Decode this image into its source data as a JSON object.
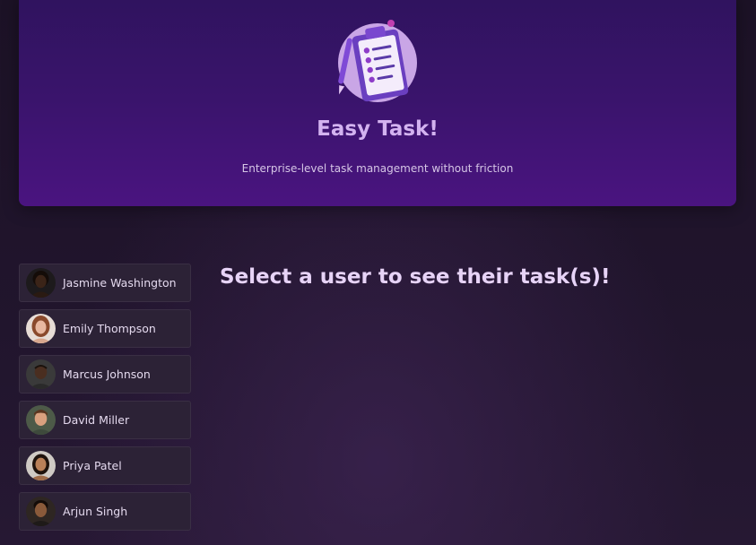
{
  "header": {
    "logo_icon": "clipboard-checklist-icon",
    "title": "Easy Task!",
    "subtitle": "Enterprise-level task management without friction"
  },
  "users": [
    {
      "name": "Jasmine Washington",
      "avatar_icon": "avatar-jasmine",
      "skin": "#3b2418",
      "hair": "#140c08"
    },
    {
      "name": "Emily Thompson",
      "avatar_icon": "avatar-emily",
      "skin": "#e8b8a0",
      "hair": "#8a4a2c"
    },
    {
      "name": "Marcus Johnson",
      "avatar_icon": "avatar-marcus",
      "skin": "#4a2e20",
      "hair": "#1a120c"
    },
    {
      "name": "David Miller",
      "avatar_icon": "avatar-david",
      "skin": "#d9a07e",
      "hair": "#5a3620"
    },
    {
      "name": "Priya Patel",
      "avatar_icon": "avatar-priya",
      "skin": "#b98058",
      "hair": "#1e120c"
    },
    {
      "name": "Arjun Singh",
      "avatar_icon": "avatar-arjun",
      "skin": "#8a5a3a",
      "hair": "#140c08"
    }
  ],
  "main": {
    "heading": "Select a user to see their task(s)!"
  },
  "colors": {
    "background": "#1a1123",
    "hero_top": "#2f135e",
    "hero_bottom": "#4a1480",
    "accent": "#d3b3f0",
    "user_item_bg": "#2c2236"
  }
}
